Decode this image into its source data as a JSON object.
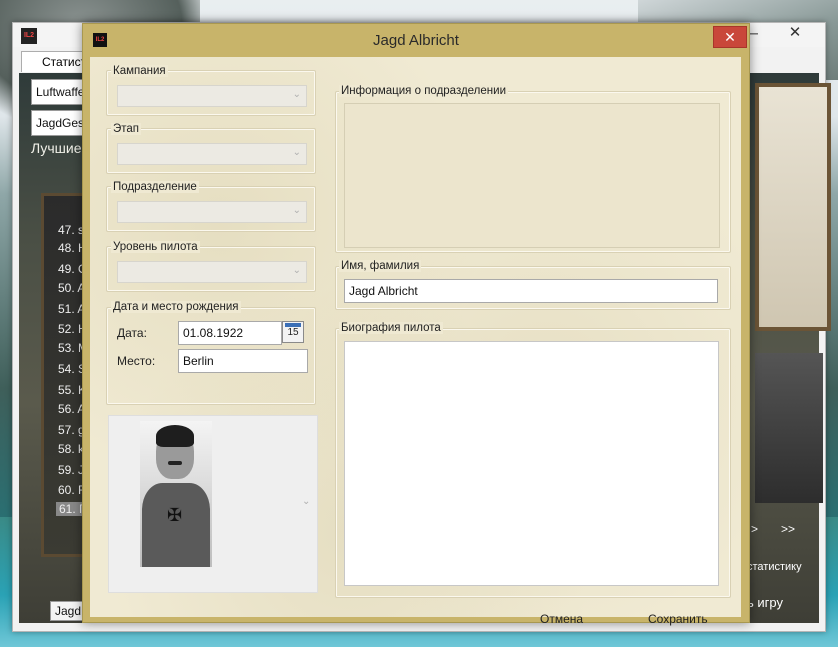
{
  "bg_app": {
    "tab_label": "Статистика",
    "combo1": "Luftwaffe",
    "combo2": "JagdGeschwader",
    "best_label": "Лучшие",
    "list_items": [
      "47. st",
      "48. H",
      "49. O",
      "50. A",
      "51. A",
      "52. H",
      "53. M",
      "54. S",
      "55. K",
      "56. A",
      "57. g",
      "58. kl",
      "59. Ja",
      "60. R",
      "61. Гi"
    ],
    "bottom_button": "Jagd",
    "nav_next": ">",
    "nav_last": ">>",
    "right_text1": "статистику",
    "right_text2": "ь игру",
    "min_glyph": "─",
    "close_glyph": "✕"
  },
  "dialog": {
    "title": "Jagd Albricht",
    "close_glyph": "✕",
    "campaign_label": "Кампания",
    "stage_label": "Этап",
    "unit_label": "Подразделение",
    "pilot_level_label": "Уровень пилота",
    "birth_group_label": "Дата и место рождения",
    "date_label": "Дата:",
    "date_value": "01.08.1922",
    "calendar_day": "15",
    "place_label": "Место:",
    "place_value": "Berlin",
    "unit_info_label": "Информация о подразделении",
    "name_label": "Имя, фамилия",
    "name_value": "Jagd Albricht",
    "bio_label": "Биография пилота",
    "cancel_label": "Отмена",
    "save_label": "Сохранить",
    "combo_arrow": "⌄"
  }
}
